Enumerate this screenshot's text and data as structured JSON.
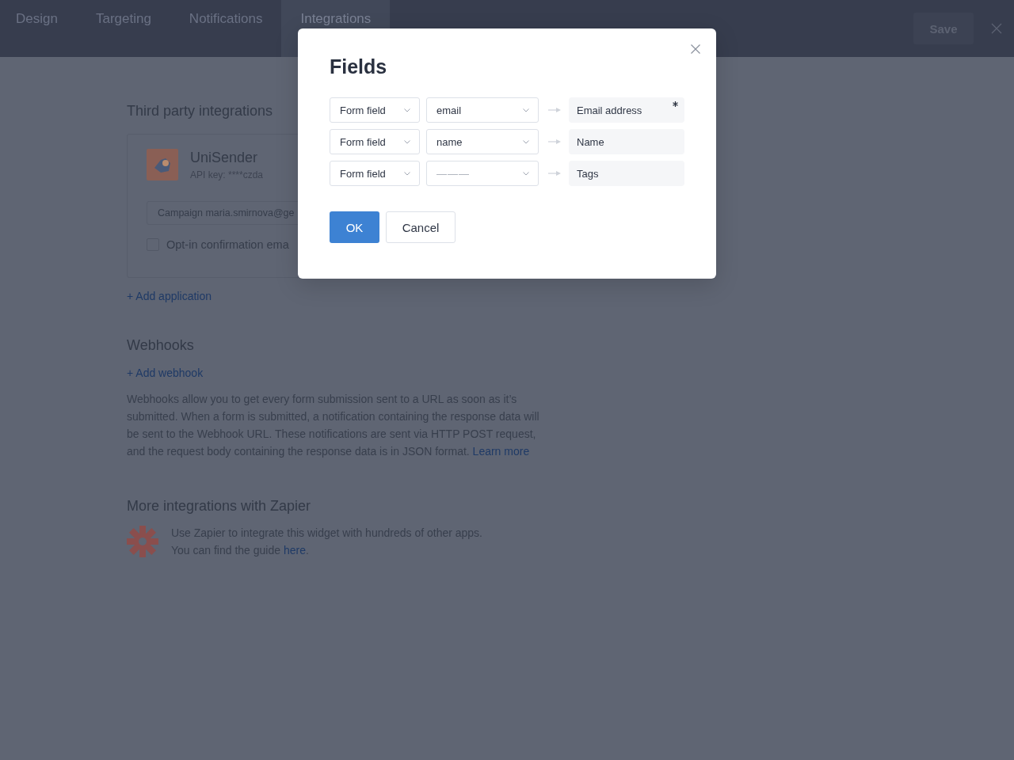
{
  "tabs": [
    {
      "label": "Design",
      "selected": false
    },
    {
      "label": "Targeting",
      "selected": false
    },
    {
      "label": "Notifications",
      "selected": false
    },
    {
      "label": "Integrations",
      "selected": true
    }
  ],
  "save_button": "Save",
  "third_party": {
    "title": "Third party integrations",
    "integrations": [
      {
        "name": "UniSender",
        "api_key": "API key: ****czda",
        "campaign": "Campaign maria.smirnova@ge",
        "opt_in": {
          "label": "Opt-in confirmation ema",
          "checked": false
        }
      }
    ],
    "add_link": "+ Add application"
  },
  "webhooks": {
    "title": "Webhooks",
    "add_link": "+ Add webhook",
    "description": "Webhooks allow you to get every form submission sent to a URL as soon as it’s submitted. When a form is submitted, a notification containing the response data will be sent to the Webhook URL. These notifications are sent via HTTP POST request, and the request body containing the response data is in JSON format.",
    "learn_more": "Learn more"
  },
  "zapier": {
    "title": "More integrations with Zapier",
    "line_1": "Use Zapier to integrate this widget with hundreds of other apps.",
    "line_2": "You can find the guide",
    "link": "here",
    "line_2_end": "."
  },
  "dialog": {
    "title": "Fields",
    "rows": [
      {
        "source": "Form field",
        "field": "email",
        "target": "Email address",
        "required": true
      },
      {
        "source": "Form field",
        "field": "name",
        "target": "Name",
        "required": false
      },
      {
        "source": "Form field",
        "placeholder": "———",
        "target": "Tags",
        "required": false
      }
    ],
    "ok_button": "OK",
    "cancel_button": "Cancel"
  }
}
